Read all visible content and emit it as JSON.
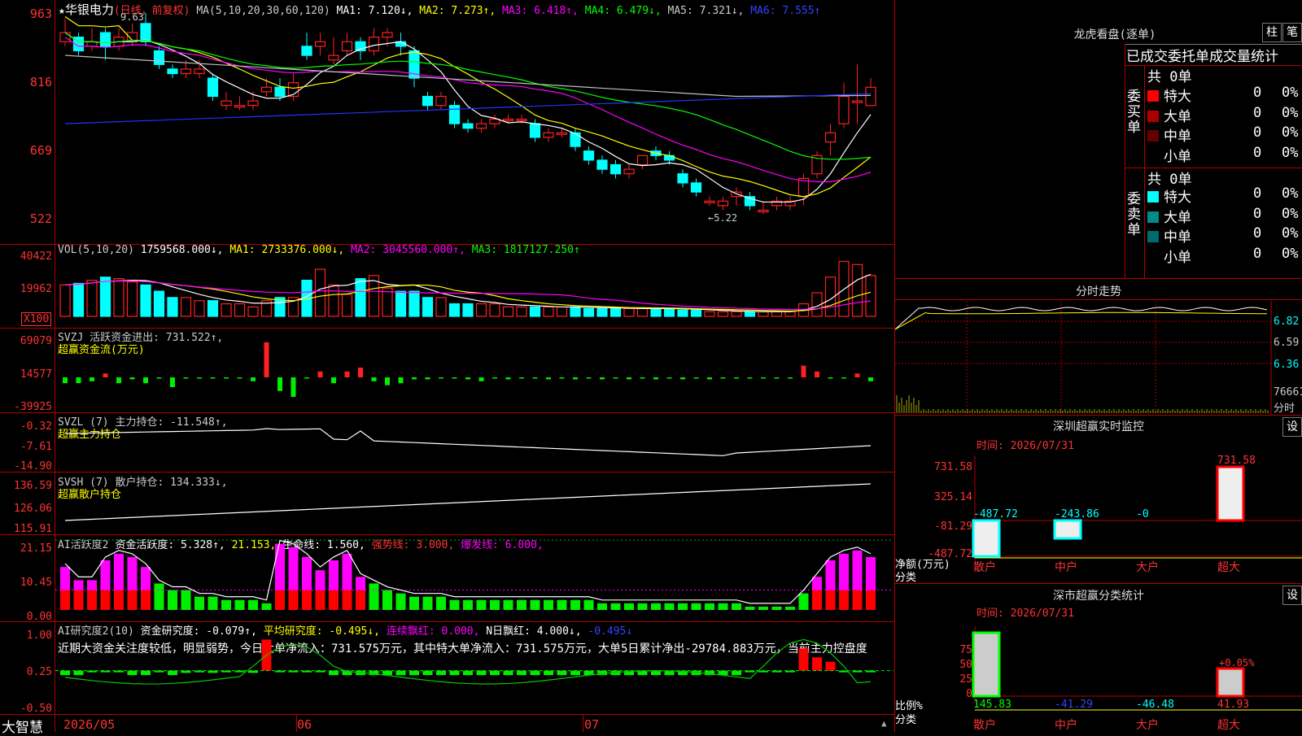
{
  "price_panel": {
    "ticks": [
      "963",
      "816",
      "669",
      "522"
    ],
    "title_star": "★",
    "stock_name": "华银电力",
    "period": "(日线，前复权)",
    "ma_title": "MA(5,10,20,30,60,120)",
    "ma1": "MA1: 7.120↓,",
    "ma2": "MA2: 7.273↑,",
    "ma3": "MA3: 6.418↑,",
    "ma4": "MA4: 6.479↓,",
    "ma5": "MA5: 7.321↓,",
    "ma6": "MA6: 7.555↑",
    "high_label": "9.63",
    "low_label": "←5.22"
  },
  "vol_panel": {
    "ticks": [
      "40422",
      "19962"
    ],
    "unit": "X100",
    "title": "VOL(5,10,20)",
    "v0": "1759568.000↓,",
    "ma1": "MA1: 2733376.000↓,",
    "ma2": "MA2: 3045560.000↑,",
    "ma3": "MA3: 1817127.250↑"
  },
  "svzj": {
    "ticks": [
      "69079",
      "14577",
      "-39925"
    ],
    "line1": "SVZJ  活跃资金进出: 731.522↑,",
    "line2": "超赢资金流(万元)"
  },
  "svzl": {
    "ticks": [
      "-0.32",
      "-7.61",
      "-14.90"
    ],
    "line1": "SVZL (7) 主力持仓: -11.548↑,",
    "line2": "超赢主力持仓"
  },
  "svsh": {
    "ticks": [
      "136.59",
      "126.06",
      "115.91"
    ],
    "line1": "SVSH (7) 散户持仓: 134.333↓,",
    "line2": "超赢散户持仓"
  },
  "ai2": {
    "ticks": [
      "21.15",
      "10.45",
      "0.00"
    ],
    "name": "AI活跃度2",
    "a": "资金活跃度: 5.328↑,",
    "b": "21.153,",
    "c": "生命线: 1.560,",
    "d": "强势线: 3.000,",
    "e": "爆发线: 6.000,"
  },
  "ai_research": {
    "ticks": [
      "1.00",
      "0.25",
      "-0.50"
    ],
    "name": "AI研究度2(10)",
    "a": "资金研究度: -0.079↑,",
    "b": "平均研究度: -0.495↓,",
    "c": "连续飘红: 0.000,",
    "d": "N日飘红: 4.000↓,",
    "e": "-0.495↓",
    "comment": "近期大资金关注度较低，明显弱势，今日大单净流入：731.575万元，其中特大单净流入：731.575万元，大单5日累计净出-29784.883万元，当前主力控盘度"
  },
  "bottom_bar": {
    "brand": "大智慧",
    "dates": [
      "2026/05",
      "06",
      "07"
    ]
  },
  "dragon": {
    "title": "龙虎看盘(逐单)",
    "btn1": "柱",
    "btn2": "笔",
    "subtitle": "已成交委托单成交量统计",
    "buy_label": "委买单",
    "sell_label": "委卖单",
    "buy_total": "共 0单",
    "sell_total": "共 0单",
    "buy_rows": [
      {
        "label": "特大",
        "count": "0",
        "pct": "0%",
        "color": "#ff0000"
      },
      {
        "label": "大单",
        "count": "0",
        "pct": "0%",
        "color": "#aa0000"
      },
      {
        "label": "中单",
        "count": "0",
        "pct": "0%",
        "color": "#660000"
      },
      {
        "label": "小单",
        "count": "0",
        "pct": "0%",
        "color": "#000000"
      }
    ],
    "sell_rows": [
      {
        "label": "特大",
        "count": "0",
        "pct": "0%",
        "color": "#00ffff"
      },
      {
        "label": "大单",
        "count": "0",
        "pct": "0%",
        "color": "#008b8b"
      },
      {
        "label": "中单",
        "count": "0",
        "pct": "0%",
        "color": "#006b6b"
      },
      {
        "label": "小单",
        "count": "0",
        "pct": "0%",
        "color": "#000000"
      }
    ]
  },
  "intraday": {
    "title": "分时走势",
    "ticks": [
      "6.82",
      "6.59",
      "6.36"
    ],
    "vol_tick": "76661",
    "vol_unit": "分时"
  },
  "sz_monitor": {
    "title": "深圳超赢实时监控",
    "setting": "设",
    "time": "时间: 2026/07/31",
    "ticks": [
      "731.58",
      "325.14",
      "-81.29",
      "-487.72"
    ],
    "ylabel": "净额(万元)",
    "xlabel": "分类",
    "categories": [
      "散户",
      "中户",
      "大户",
      "超大"
    ],
    "values": [
      -487.72,
      -243.86,
      0,
      731.58
    ],
    "value_labels": [
      "-487.72",
      "-243.86",
      "-0",
      "731.58"
    ]
  },
  "sz_stats": {
    "title": "深市超赢分类统计",
    "setting": "设",
    "time": "时间: 2026/07/31",
    "ticks": [
      "75",
      "50",
      "25",
      "0"
    ],
    "ylabel": "比例%",
    "xlabel": "分类",
    "categories": [
      "散户",
      "中户",
      "大户",
      "超大"
    ],
    "value_labels": [
      "145.83",
      "-41.29",
      "-46.48",
      "41.93"
    ],
    "values": [
      145.83,
      -41.29,
      -46.48,
      41.93
    ],
    "annotation": "+0.05%"
  },
  "colors": {
    "up": "#ff2020",
    "down": "#00ffff",
    "grid": "#b00000",
    "ma1": "#ffffff",
    "ma2": "#ffff00",
    "ma3": "#ff00ff",
    "ma4": "#00ff00",
    "ma5": "#c0c0c0",
    "ma6": "#0000ff"
  }
}
